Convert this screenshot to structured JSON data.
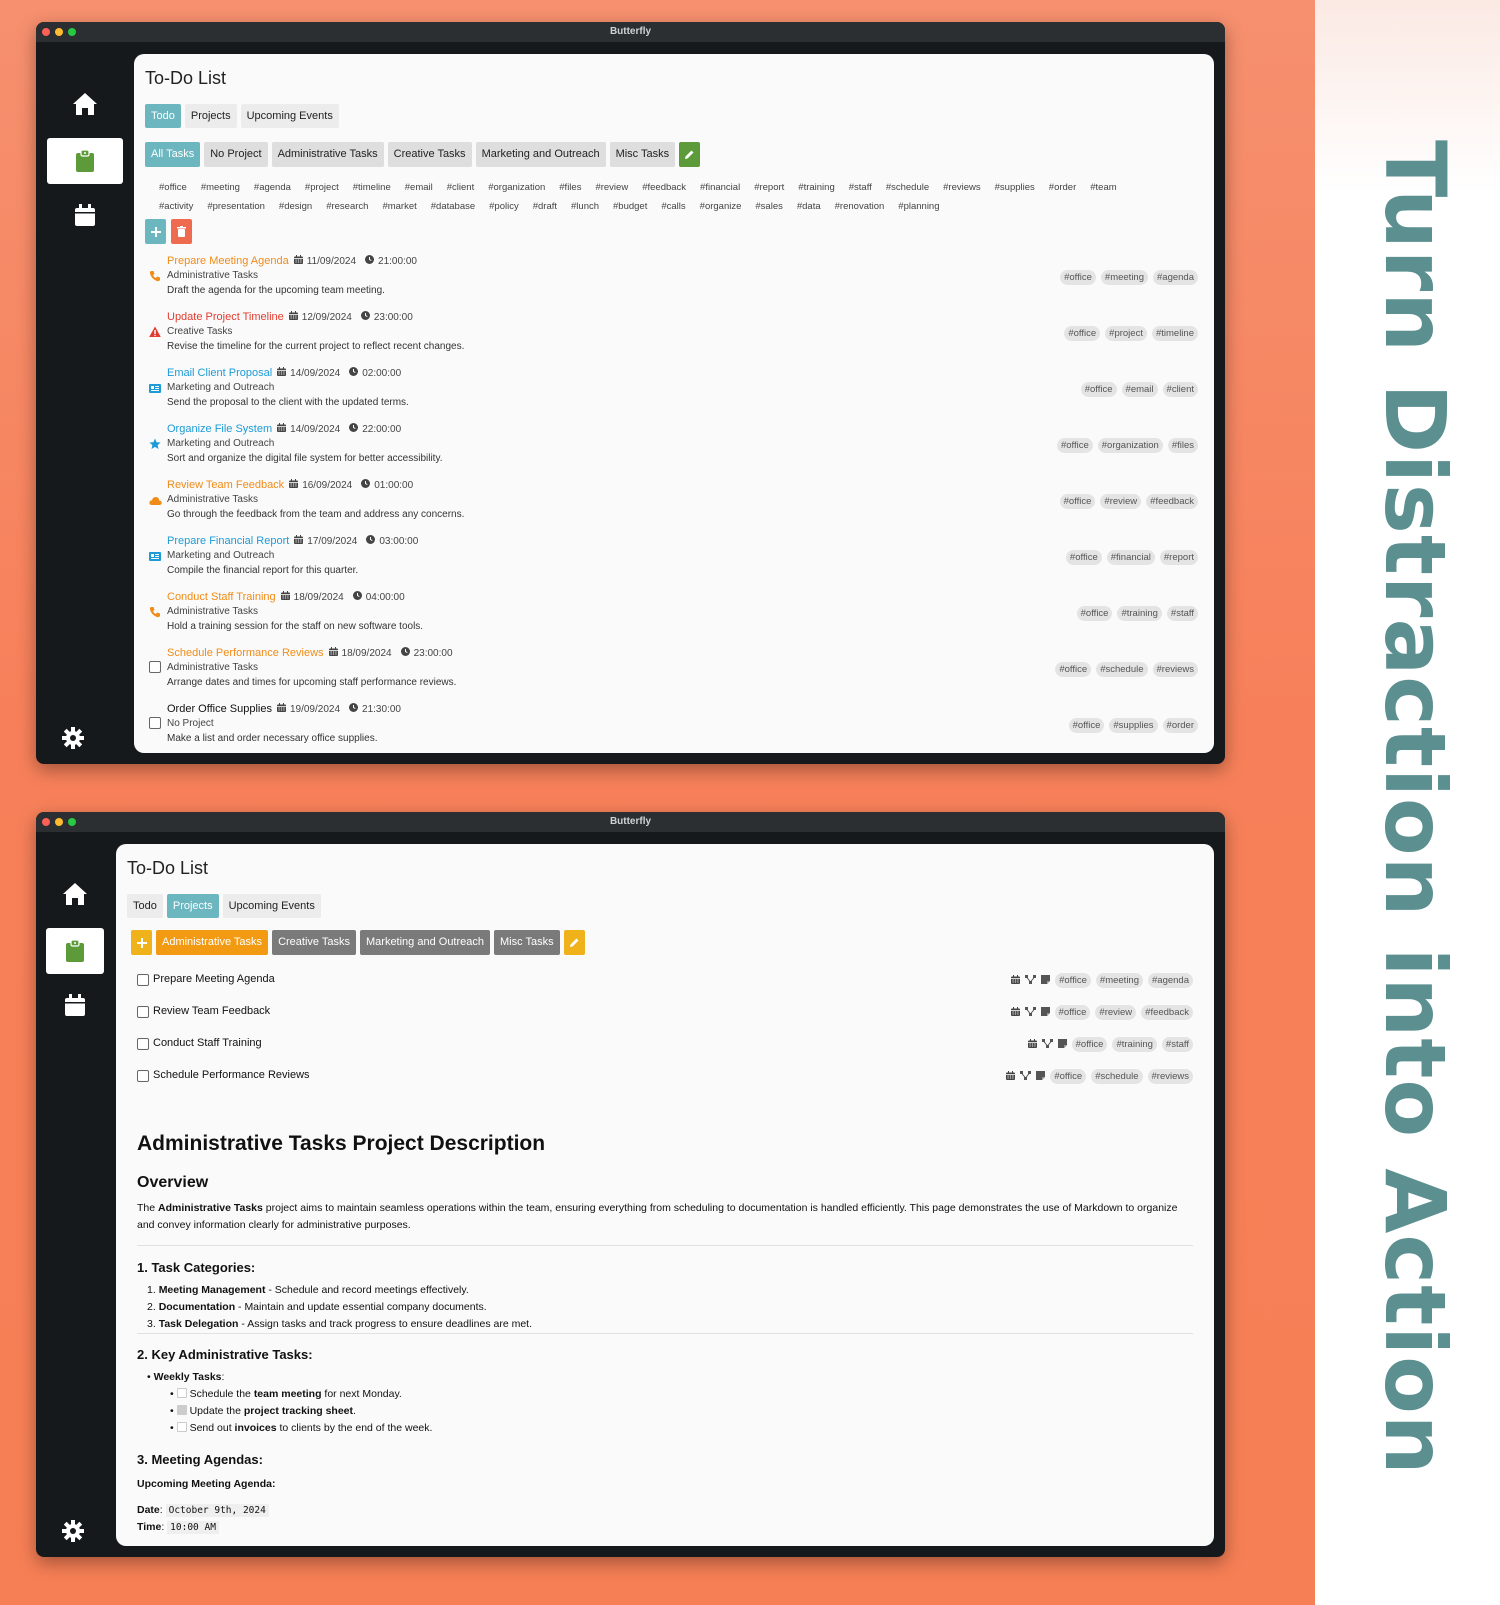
{
  "app_title": "Butterfly",
  "slogan": "Turn Distraction into Action",
  "sidebar": {
    "items": [
      "home-icon",
      "clipboard-icon",
      "calendar-icon",
      "gear-icon"
    ]
  },
  "todo_window": {
    "page_title": "To-Do List",
    "main_tabs": [
      {
        "label": "Todo",
        "active": true
      },
      {
        "label": "Projects",
        "active": false
      },
      {
        "label": "Upcoming Events",
        "active": false
      }
    ],
    "filter_tabs": [
      {
        "label": "All Tasks",
        "active": true
      },
      {
        "label": "No Project"
      },
      {
        "label": "Administrative Tasks"
      },
      {
        "label": "Creative Tasks"
      },
      {
        "label": "Marketing and Outreach"
      },
      {
        "label": "Misc Tasks"
      }
    ],
    "tag_cloud": [
      "#office",
      "#meeting",
      "#agenda",
      "#project",
      "#timeline",
      "#email",
      "#client",
      "#organization",
      "#files",
      "#review",
      "#feedback",
      "#financial",
      "#report",
      "#training",
      "#staff",
      "#schedule",
      "#reviews",
      "#supplies",
      "#order",
      "#team",
      "#activity",
      "#presentation",
      "#design",
      "#research",
      "#market",
      "#database",
      "#policy",
      "#draft",
      "#lunch",
      "#budget",
      "#calls",
      "#organize",
      "#sales",
      "#data",
      "#renovation",
      "#planning"
    ],
    "tasks": [
      {
        "name": "Prepare Meeting Agenda",
        "color": "orange",
        "icon": "phone-icon",
        "date": "11/09/2024",
        "time": "21:00:00",
        "project": "Administrative Tasks",
        "desc": "Draft the agenda for the upcoming team meeting.",
        "tags": [
          "#office",
          "#meeting",
          "#agenda"
        ]
      },
      {
        "name": "Update Project Timeline",
        "color": "red",
        "icon": "warning-icon",
        "date": "12/09/2024",
        "time": "23:00:00",
        "project": "Creative Tasks",
        "desc": "Revise the timeline for the current project to reflect recent changes.",
        "tags": [
          "#office",
          "#project",
          "#timeline"
        ]
      },
      {
        "name": "Email Client Proposal",
        "color": "blue",
        "icon": "newspaper-icon",
        "date": "14/09/2024",
        "time": "02:00:00",
        "project": "Marketing and Outreach",
        "desc": "Send the proposal to the client with the updated terms.",
        "tags": [
          "#office",
          "#email",
          "#client"
        ]
      },
      {
        "name": "Organize File System",
        "color": "blue",
        "icon": "star-icon",
        "date": "14/09/2024",
        "time": "22:00:00",
        "project": "Marketing and Outreach",
        "desc": "Sort and organize the digital file system for better accessibility.",
        "tags": [
          "#office",
          "#organization",
          "#files"
        ]
      },
      {
        "name": "Review Team Feedback",
        "color": "orange",
        "icon": "cloud-icon",
        "date": "16/09/2024",
        "time": "01:00:00",
        "project": "Administrative Tasks",
        "desc": "Go through the feedback from the team and address any concerns.",
        "tags": [
          "#office",
          "#review",
          "#feedback"
        ]
      },
      {
        "name": "Prepare Financial Report",
        "color": "blue",
        "icon": "newspaper-icon",
        "date": "17/09/2024",
        "time": "03:00:00",
        "project": "Marketing and Outreach",
        "desc": "Compile the financial report for this quarter.",
        "tags": [
          "#office",
          "#financial",
          "#report"
        ]
      },
      {
        "name": "Conduct Staff Training",
        "color": "orange",
        "icon": "phone-icon",
        "date": "18/09/2024",
        "time": "04:00:00",
        "project": "Administrative Tasks",
        "desc": "Hold a training session for the staff on new software tools.",
        "tags": [
          "#office",
          "#training",
          "#staff"
        ]
      },
      {
        "name": "Schedule Performance Reviews",
        "color": "orange",
        "icon": "checkbox-icon",
        "date": "18/09/2024",
        "time": "23:00:00",
        "project": "Administrative Tasks",
        "desc": "Arrange dates and times for upcoming staff performance reviews.",
        "tags": [
          "#office",
          "#schedule",
          "#reviews"
        ]
      },
      {
        "name": "Order Office Supplies",
        "color": "black",
        "icon": "checkbox-icon",
        "date": "19/09/2024",
        "time": "21:30:00",
        "project": "No Project",
        "desc": "Make a list and order necessary office supplies.",
        "tags": [
          "#office",
          "#supplies",
          "#order"
        ]
      }
    ]
  },
  "projects_window": {
    "page_title": "To-Do List",
    "main_tabs": [
      {
        "label": "Todo",
        "active": false
      },
      {
        "label": "Projects",
        "active": true
      },
      {
        "label": "Upcoming Events",
        "active": false
      }
    ],
    "project_tabs": [
      {
        "label": "Administrative Tasks",
        "active": true
      },
      {
        "label": "Creative Tasks"
      },
      {
        "label": "Marketing and Outreach"
      },
      {
        "label": "Misc Tasks"
      }
    ],
    "project_tasks": [
      {
        "name": "Prepare Meeting Agenda",
        "tags": [
          "#office",
          "#meeting",
          "#agenda"
        ]
      },
      {
        "name": "Review Team Feedback",
        "tags": [
          "#office",
          "#review",
          "#feedback"
        ]
      },
      {
        "name": "Conduct Staff Training",
        "tags": [
          "#office",
          "#training",
          "#staff"
        ]
      },
      {
        "name": "Schedule Performance Reviews",
        "tags": [
          "#office",
          "#schedule",
          "#reviews"
        ]
      }
    ],
    "description": {
      "h1": "Administrative Tasks Project Description",
      "overview_h": "Overview",
      "overview_pre": "The ",
      "overview_bold": "Administrative Tasks",
      "overview_post": " project aims to maintain seamless operations within the team, ensuring everything from scheduling to documentation is handled efficiently. This page demonstrates the use of Markdown to organize and convey information clearly for administrative purposes.",
      "cat_h": "1. Task Categories:",
      "categories": [
        {
          "num": "1.",
          "bold": "Meeting Management",
          "text": " - Schedule and record meetings effectively."
        },
        {
          "num": "2.",
          "bold": "Documentation",
          "text": " - Maintain and update essential company documents."
        },
        {
          "num": "3.",
          "bold": "Task Delegation",
          "text": " - Assign tasks and track progress to ensure deadlines are met."
        }
      ],
      "key_h": "2. Key Administrative Tasks:",
      "weekly_label": "Weekly Tasks",
      "weekly": [
        {
          "checked": false,
          "pre": "Schedule the ",
          "bold": "team meeting",
          "post": " for next Monday."
        },
        {
          "checked": true,
          "pre": "Update the ",
          "bold": "project tracking sheet",
          "post": "."
        },
        {
          "checked": false,
          "pre": "Send out ",
          "bold": "invoices",
          "post": " to clients by the end of the week."
        }
      ],
      "agenda_h": "3. Meeting Agendas:",
      "upcoming_label": "Upcoming Meeting Agenda:",
      "date_label": "Date",
      "date_value": "October 9th, 2024",
      "time_label": "Time",
      "time_value": "10:00 AM"
    }
  }
}
